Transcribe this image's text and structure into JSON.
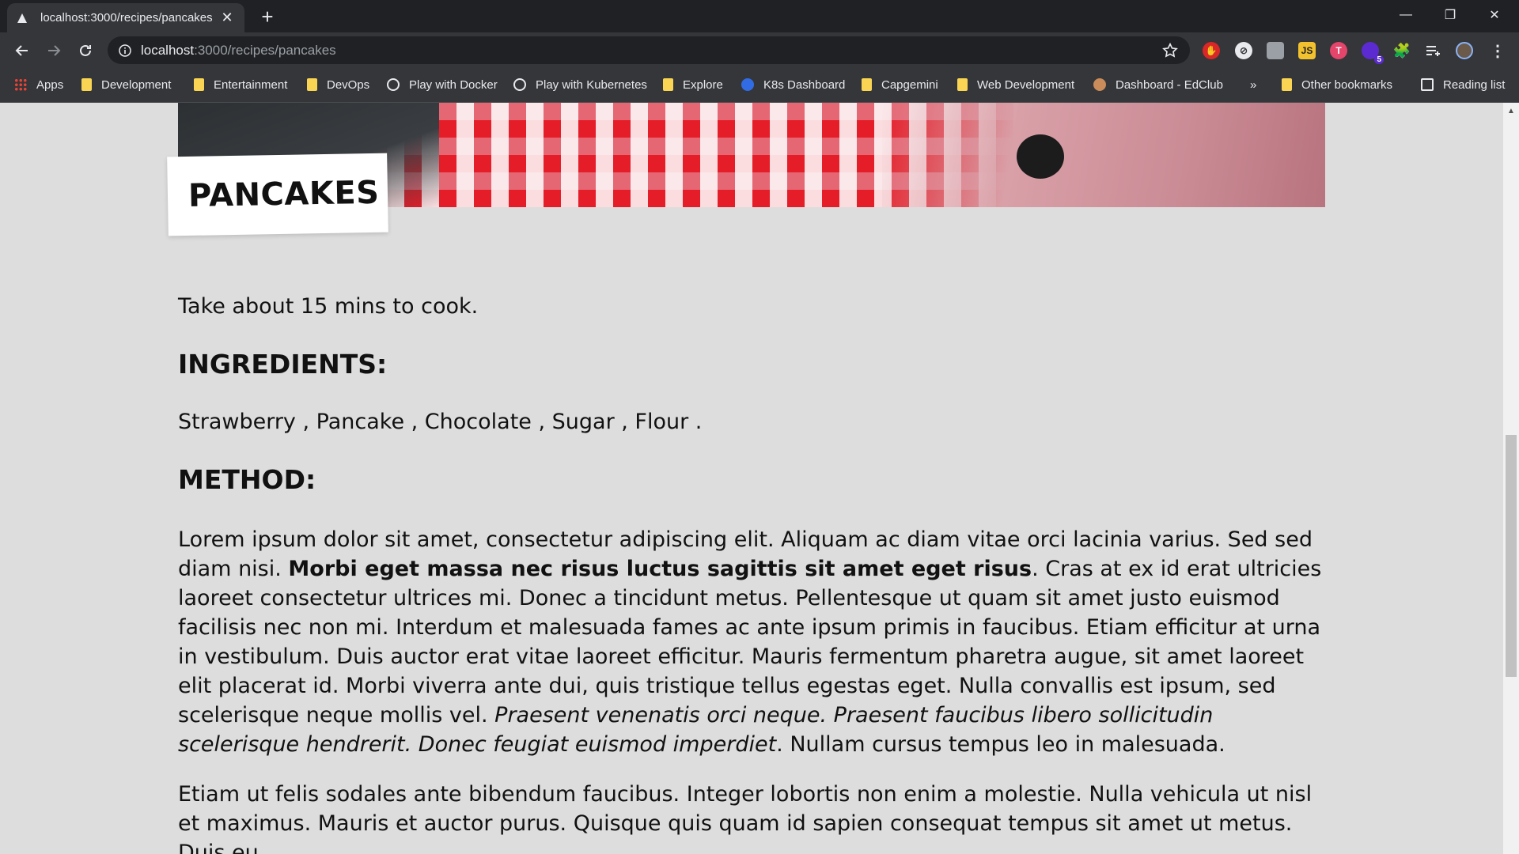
{
  "tab": {
    "title": "localhost:3000/recipes/pancakes"
  },
  "omnibox": {
    "host": "localhost",
    "path": ":3000/recipes/pancakes"
  },
  "bookmarks": [
    "Apps",
    "Development",
    "Entertainment",
    "DevOps",
    "Play with Docker",
    "Play with Kubernetes",
    "Explore",
    "K8s Dashboard",
    "Capgemini",
    "Web Development",
    "Dashboard - EdClub",
    "»",
    "Other bookmarks",
    "Reading list"
  ],
  "extensions": {
    "badge_count": "5"
  },
  "recipe": {
    "title": "PANCAKES",
    "cook_time": "Take about 15 mins to cook.",
    "ingredients_heading": "INGREDIENTS:",
    "ingredients": "Strawberry , Pancake , Chocolate , Sugar , Flour .",
    "method_heading": "METHOD:",
    "method_p1_a": "Lorem ipsum dolor sit amet, consectetur adipiscing elit. Aliquam ac diam vitae orci lacinia varius. Sed sed diam nisi. ",
    "method_p1_bold": "Morbi eget massa nec risus luctus sagittis sit amet eget risus",
    "method_p1_b": ". Cras at ex id erat ultricies laoreet consectetur ultrices mi. Donec a tincidunt metus. Pellentesque ut quam sit amet justo euismod facilisis nec non mi. Interdum et malesuada fames ac ante ipsum primis in faucibus. Etiam efficitur at urna in vestibulum. Duis auctor erat vitae laoreet efficitur. Mauris fermentum pharetra augue, sit amet laoreet elit placerat id. Morbi viverra ante dui, quis tristique tellus egestas eget. Nulla convallis est ipsum, sed scelerisque neque mollis vel. ",
    "method_p1_italic": "Praesent venenatis orci neque. Praesent faucibus libero sollicitudin scelerisque hendrerit. Donec feugiat euismod imperdiet",
    "method_p1_c": ". Nullam cursus tempus leo in malesuada.",
    "method_p2": "Etiam ut felis sodales ante bibendum faucibus. Integer lobortis non enim a molestie. Nulla vehicula ut nisl et maximus. Mauris et auctor purus. Quisque quis quam id sapien consequat tempus sit amet ut metus. Duis eu"
  }
}
